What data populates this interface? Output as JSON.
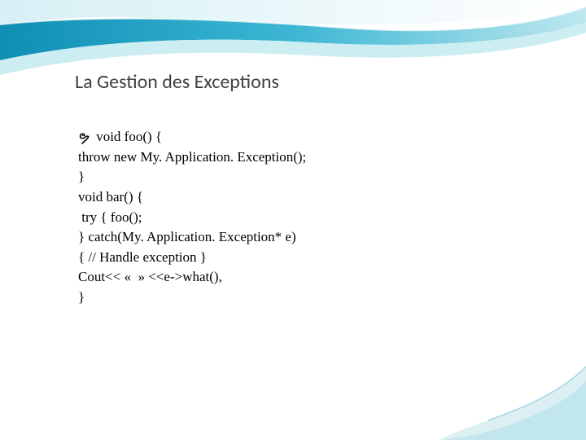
{
  "slide": {
    "title": "La Gestion des Exceptions",
    "bullet_glyph": "ຯ",
    "lines": [
      "void foo() {",
      "throw new My. Application. Exception();",
      "}",
      "void bar() {",
      " try { foo();",
      "} catch(My. Application. Exception* e)",
      "{ // Handle exception }",
      "Cout<< «  » <<e->what(),",
      "}"
    ]
  },
  "theme": {
    "accent": "#1aa3c9",
    "accent_light": "#bfe8ef",
    "accent_mid": "#64c7db",
    "corner": "#c9e9ef"
  }
}
